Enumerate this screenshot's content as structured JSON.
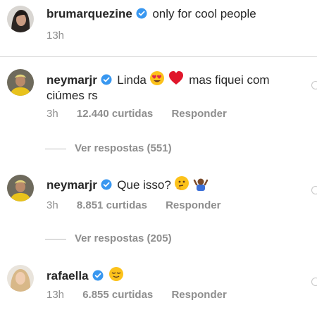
{
  "caption": {
    "username": "brumarquezine",
    "text": "only for cool people",
    "time": "13h"
  },
  "comments": [
    {
      "username": "neymarjr",
      "text_before": "Linda",
      "text_after": "mas fiquei com",
      "text_line2": "ciúmes rs",
      "time": "3h",
      "likes": "12.440 curtidas",
      "reply": "Responder",
      "view_replies": "Ver respostas (551)",
      "emojis": [
        "heart-eyes-emoji",
        "red-heart-emoji"
      ]
    },
    {
      "username": "neymarjr",
      "text_before": "Que isso?",
      "time": "3h",
      "likes": "8.851 curtidas",
      "reply": "Responder",
      "view_replies": "Ver respostas (205)",
      "emojis": [
        "thinking-emoji",
        "shrug-emoji"
      ]
    },
    {
      "username": "rafaella",
      "time": "13h",
      "likes": "6.855 curtidas",
      "reply": "Responder",
      "emojis": [
        "relieved-smile-emoji"
      ]
    }
  ],
  "colors": {
    "verified": "#3897f0",
    "muted": "#8e8e8e",
    "text": "#262626",
    "divider": "#dbdbdb"
  }
}
